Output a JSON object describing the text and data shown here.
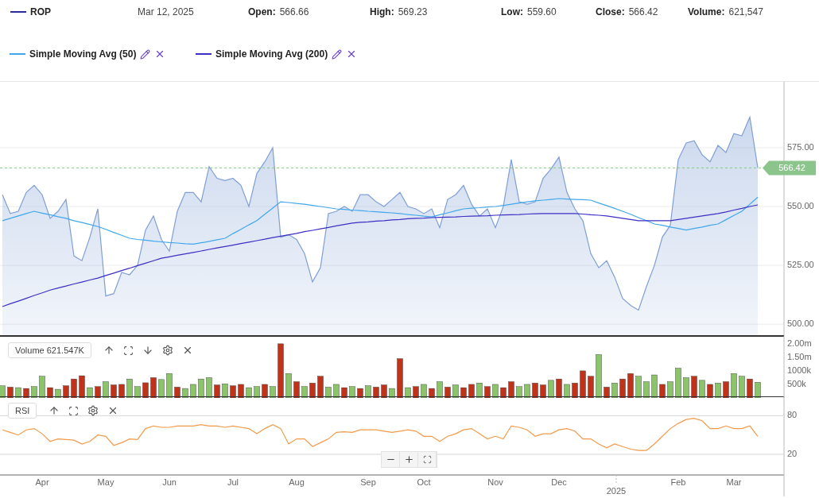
{
  "symbol": {
    "color": "#2b2b9e"
  },
  "date": "Mar 12, 2025",
  "stats": [
    {
      "label": "Open:",
      "value": "566.66"
    },
    {
      "label": "High:",
      "value": "569.23"
    },
    {
      "label": "Low:",
      "value": "559.60"
    },
    {
      "label": "Close:",
      "value": "566.42"
    },
    {
      "label": "Volume:",
      "value": "621,547"
    }
  ],
  "price_chart": {
    "chart_data": {
      "type": "line",
      "grid": true,
      "ref_lines": [
        {
          "axis": "y",
          "value": 566.42,
          "label": "566.42",
          "color": "#8bc58b"
        }
      ],
      "ylim": [
        495,
        603
      ],
      "yticks": [
        {
          "value": 500,
          "label": "500.00"
        },
        {
          "value": 525,
          "label": "525.00"
        },
        {
          "value": 550,
          "label": "550.00"
        },
        {
          "value": 575,
          "label": "575.00"
        }
      ],
      "series": [
        {
          "name": "ROP",
          "type": "area",
          "color": "#7f9fd4",
          "values": [
            555,
            547,
            548,
            556,
            559,
            555,
            545,
            548,
            553,
            529,
            527,
            537,
            549,
            512,
            513,
            522,
            521,
            525,
            540,
            546,
            536,
            531,
            548,
            556,
            556,
            552,
            567,
            562,
            561,
            562,
            559,
            550,
            564,
            569,
            575,
            537,
            538,
            536,
            530,
            518,
            524,
            547,
            548,
            550,
            548,
            555,
            555,
            552,
            550,
            553,
            556,
            550,
            549,
            547,
            549,
            541,
            553,
            555,
            559,
            551,
            546,
            549,
            541,
            550,
            570,
            552,
            551,
            552,
            562,
            566,
            571,
            556,
            549,
            544,
            530,
            524,
            527,
            520,
            511,
            508,
            506,
            516,
            525,
            537,
            542,
            570,
            577,
            578,
            572,
            569,
            576,
            573,
            581,
            580,
            588,
            566.4
          ]
        },
        {
          "name": "Simple Moving Avg (50)",
          "color": "#41a7ec",
          "values": [
            544,
            545,
            546,
            547,
            548,
            547.2,
            546.5,
            545.7,
            545,
            544,
            543.2,
            542.4,
            541.5,
            540.3,
            539,
            537.8,
            536.5,
            536,
            535.7,
            535.3,
            535,
            534.7,
            534.5,
            534.2,
            534,
            534.6,
            535.2,
            535.9,
            536.5,
            538.5,
            540.3,
            542.2,
            544,
            546.7,
            549.3,
            552,
            551.7,
            551.3,
            551,
            550.5,
            550,
            549.5,
            549,
            548.8,
            548.5,
            548.3,
            548,
            547.8,
            547.5,
            547.3,
            547,
            546.6,
            546.3,
            545.9,
            545.6,
            546.5,
            547.3,
            548.2,
            549,
            549.3,
            549.5,
            549.8,
            550,
            550.5,
            551,
            551.5,
            552,
            552.4,
            552.7,
            553,
            553.4,
            553.2,
            553,
            552.9,
            552.7,
            551.5,
            550.4,
            549.2,
            548,
            546.7,
            545.3,
            544,
            542.6,
            542,
            541.3,
            540.7,
            540,
            540.7,
            541.3,
            542,
            542.6,
            544.4,
            546.2,
            548,
            551,
            554
          ]
        },
        {
          "name": "Simple Moving Avg (200)",
          "color": "#3d2fc4",
          "values": [
            507.5,
            508.7,
            509.8,
            511,
            512.2,
            513.3,
            514.5,
            515.4,
            516.2,
            517.1,
            517.9,
            518.8,
            519.6,
            520.7,
            521.7,
            522.8,
            523.8,
            524.9,
            525.9,
            527,
            528,
            528.6,
            529.3,
            529.9,
            530.5,
            531.1,
            531.8,
            532.4,
            533,
            533.6,
            534.3,
            534.9,
            535.5,
            536.1,
            536.8,
            537.4,
            538,
            538.6,
            539.3,
            539.9,
            540.5,
            541.1,
            541.8,
            542.4,
            543,
            543.3,
            543.5,
            543.8,
            544,
            544.3,
            544.5,
            544.8,
            545,
            545.1,
            545.3,
            545.4,
            545.5,
            545.6,
            545.8,
            545.9,
            546,
            546.1,
            546.3,
            546.4,
            546.5,
            546.6,
            546.8,
            546.9,
            547,
            547,
            547,
            547,
            547,
            546.8,
            546.5,
            546.3,
            546,
            545.5,
            545,
            544.5,
            544,
            544,
            544,
            544,
            544,
            544.5,
            545,
            545.5,
            546,
            546.5,
            547,
            547.7,
            548.5,
            549.2,
            550,
            550.7
          ]
        }
      ]
    }
  },
  "volume_panel": {
    "label": "Volume 621.547K",
    "chart_data": {
      "type": "bar",
      "stacked": true,
      "ylim": [
        0,
        2260000
      ],
      "yticks": [
        {
          "value": 500000,
          "label": "500k"
        },
        {
          "value": 1000000,
          "label": "1000k"
        },
        {
          "value": 1500000,
          "label": "1.50m"
        },
        {
          "value": 2000000,
          "label": "2.00m"
        }
      ],
      "series": [
        {
          "color": "#8cc46b",
          "values": [
            450000,
            null,
            380000,
            null,
            420000,
            800000,
            null,
            320000,
            null,
            null,
            null,
            380000,
            null,
            600000,
            null,
            null,
            700000,
            420000,
            null,
            null,
            680000,
            900000,
            null,
            350000,
            500000,
            700000,
            750000,
            null,
            520000,
            null,
            null,
            380000,
            420000,
            null,
            420000,
            null,
            900000,
            null,
            420000,
            null,
            null,
            400000,
            500000,
            null,
            420000,
            null,
            450000,
            null,
            null,
            350000,
            null,
            380000,
            null,
            500000,
            null,
            600000,
            null,
            480000,
            null,
            null,
            550000,
            null,
            500000,
            null,
            null,
            420000,
            500000,
            null,
            null,
            650000,
            null,
            500000,
            null,
            null,
            null,
            1600000,
            null,
            550000,
            null,
            null,
            800000,
            600000,
            850000,
            null,
            600000,
            1100000,
            750000,
            null,
            650000,
            null,
            550000,
            null,
            900000,
            800000,
            null,
            580000
          ]
        },
        {
          "color": "#c0331a",
          "values": [
            null,
            400000,
            null,
            350000,
            null,
            null,
            380000,
            null,
            450000,
            700000,
            820000,
            null,
            420000,
            null,
            480000,
            500000,
            null,
            null,
            560000,
            750000,
            null,
            null,
            400000,
            null,
            null,
            null,
            null,
            480000,
            null,
            450000,
            500000,
            null,
            null,
            500000,
            null,
            2000000,
            null,
            600000,
            null,
            550000,
            800000,
            null,
            null,
            380000,
            null,
            350000,
            null,
            400000,
            480000,
            null,
            1450000,
            null,
            420000,
            null,
            350000,
            null,
            400000,
            null,
            380000,
            500000,
            null,
            420000,
            null,
            380000,
            600000,
            null,
            null,
            550000,
            480000,
            null,
            700000,
            null,
            550000,
            1000000,
            800000,
            null,
            400000,
            null,
            700000,
            900000,
            null,
            null,
            null,
            500000,
            null,
            null,
            null,
            800000,
            null,
            500000,
            null,
            600000,
            null,
            null,
            700000,
            null
          ]
        }
      ]
    }
  },
  "rsi_panel": {
    "chart_data": {
      "type": "line",
      "ylim": [
        -12,
        110
      ],
      "yticks": [
        {
          "value": 20,
          "label": "20"
        },
        {
          "value": 80,
          "label": "80"
        }
      ],
      "categories": [
        null,
        null,
        null,
        null,
        null,
        "Apr",
        null,
        null,
        null,
        null,
        null,
        null,
        null,
        "May",
        null,
        null,
        null,
        null,
        null,
        null,
        null,
        "Jun",
        null,
        null,
        null,
        null,
        null,
        null,
        null,
        "Jul",
        null,
        null,
        null,
        null,
        null,
        null,
        null,
        "Aug",
        null,
        null,
        null,
        null,
        null,
        null,
        null,
        null,
        "Sep",
        null,
        null,
        null,
        null,
        null,
        null,
        "Oct",
        null,
        null,
        null,
        null,
        null,
        null,
        null,
        null,
        "Nov",
        null,
        null,
        null,
        null,
        null,
        null,
        null,
        "Dec",
        null,
        null,
        null,
        null,
        null,
        null,
        null,
        null,
        null,
        null,
        null,
        null,
        null,
        null,
        "Feb",
        null,
        null,
        null,
        null,
        null,
        null,
        "Mar",
        null,
        null,
        null
      ],
      "annotations": [
        "2025"
      ],
      "series": [
        {
          "name": "RSI",
          "color": "#f39a4a",
          "values": [
            58,
            54,
            50,
            58,
            60,
            52,
            40,
            44,
            43,
            42,
            36,
            40,
            50,
            48,
            34,
            38,
            44,
            43,
            60,
            64,
            62,
            62,
            64,
            64,
            64,
            66,
            64,
            64,
            62,
            64,
            62,
            60,
            52,
            60,
            66,
            60,
            36,
            44,
            44,
            32,
            38,
            44,
            54,
            55,
            54,
            58,
            58,
            58,
            56,
            54,
            56,
            58,
            56,
            48,
            48,
            40,
            48,
            52,
            58,
            60,
            52,
            44,
            48,
            44,
            64,
            62,
            58,
            48,
            52,
            52,
            58,
            60,
            56,
            44,
            44,
            36,
            30,
            36,
            32,
            28,
            26,
            26,
            36,
            48,
            60,
            68,
            74,
            76,
            72,
            60,
            60,
            64,
            60,
            60,
            64,
            48
          ]
        }
      ]
    }
  }
}
